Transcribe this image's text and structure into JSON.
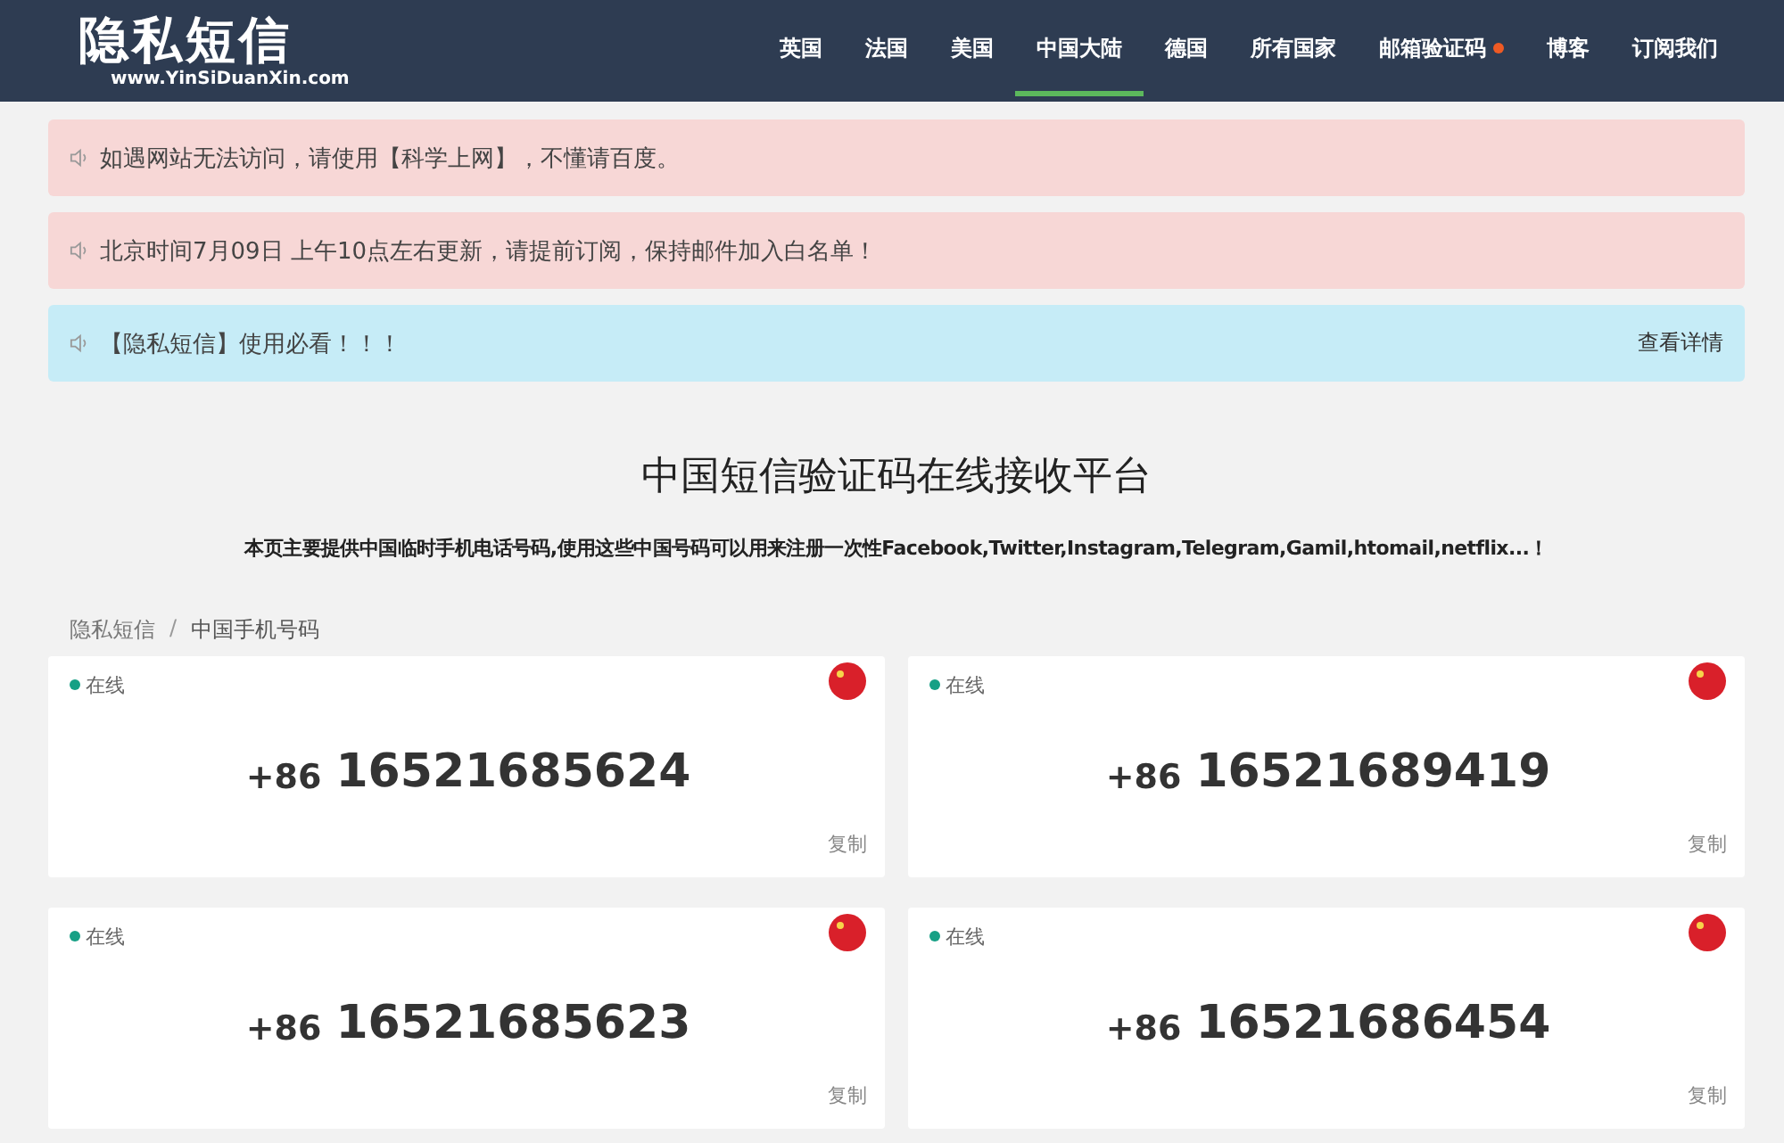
{
  "logo": {
    "title": "隐私短信",
    "url": "www.YinSiDuanXin.com"
  },
  "nav": [
    {
      "label": "英国",
      "selected": false,
      "dot": false
    },
    {
      "label": "法国",
      "selected": false,
      "dot": false
    },
    {
      "label": "美国",
      "selected": false,
      "dot": false
    },
    {
      "label": "中国大陆",
      "selected": true,
      "dot": false
    },
    {
      "label": "德国",
      "selected": false,
      "dot": false
    },
    {
      "label": "所有国家",
      "selected": false,
      "dot": false
    },
    {
      "label": "邮箱验证码",
      "selected": false,
      "dot": true
    },
    {
      "label": "博客",
      "selected": false,
      "dot": false
    },
    {
      "label": "订阅我们",
      "selected": false,
      "dot": false
    }
  ],
  "alerts": [
    {
      "kind": "warning",
      "text": "如遇网站无法访问，请使用【科学上网】，不懂请百度。"
    },
    {
      "kind": "warning",
      "text": "北京时间7月09日 上午10点左右更新，请提前订阅，保持邮件加入白名单！"
    },
    {
      "kind": "info",
      "text": "【隐私短信】使用必看！！！",
      "link": "查看详情"
    }
  ],
  "heading": "中国短信验证码在线接收平台",
  "intro": "本页主要提供中国临时手机电话号码,使用这些中国号码可以用来注册一次性Facebook,Twitter,Instagram,Telegram,Gamil,htomail,netflix...！",
  "breadcrumb": [
    "隐私短信",
    "中国手机号码"
  ],
  "breadcrumb_separator": "/",
  "numbers": [
    {
      "status": "在线",
      "online": true,
      "code": "+86",
      "number": "16521685624",
      "copy": "复制"
    },
    {
      "status": "在线",
      "online": true,
      "code": "+86",
      "number": "16521689419",
      "copy": "复制"
    },
    {
      "status": "在线",
      "online": true,
      "code": "+86",
      "number": "16521685623",
      "copy": "复制"
    },
    {
      "status": "在线",
      "online": true,
      "code": "+86",
      "number": "16521686454",
      "copy": "复制"
    }
  ]
}
